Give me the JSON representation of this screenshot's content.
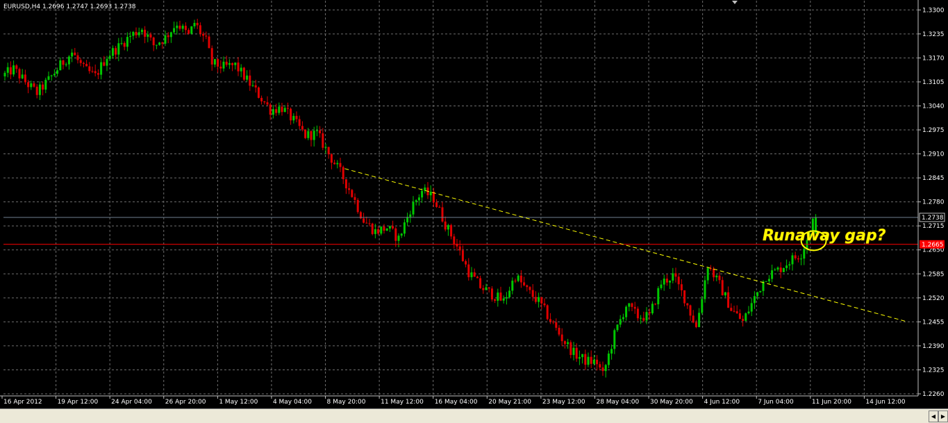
{
  "header": {
    "symbol_info": "EURUSD,H4  1.2696 1.2747 1.2693 1.2738"
  },
  "annotation": {
    "text": "Runaway gap?"
  },
  "colors": {
    "background": "#000000",
    "grid": "#6e6e6e",
    "bull": "#00c800",
    "bear": "#e00000",
    "trendline": "#ffff00",
    "annotation": "#ffff00",
    "bid_line": "#ff0000",
    "ask_line": "#708090",
    "text": "#ffffff"
  },
  "chart_data": {
    "type": "candlestick",
    "title": "EURUSD,H4",
    "ohlc": {
      "open": 1.2696,
      "high": 1.2747,
      "low": 1.2693,
      "close": 1.2738
    },
    "ylim": [
      1.226,
      1.3325
    ],
    "y_ticks": [
      "1.3300",
      "1.3235",
      "1.3170",
      "1.3105",
      "1.3040",
      "1.2975",
      "1.2910",
      "1.2845",
      "1.2780",
      "1.2715",
      "1.2650",
      "1.2585",
      "1.2520",
      "1.2455",
      "1.2390",
      "1.2325",
      "1.2260"
    ],
    "x_ticks": [
      "16 Apr 2012",
      "19 Apr 12:00",
      "24 Apr 04:00",
      "26 Apr 20:00",
      "1 May 12:00",
      "4 May 04:00",
      "8 May 20:00",
      "11 May 12:00",
      "16 May 04:00",
      "20 May 21:00",
      "23 May 12:00",
      "28 May 04:00",
      "30 May 20:00",
      "4 Jun 12:00",
      "7 Jun 04:00",
      "11 Jun 20:00",
      "14 Jun 12:00"
    ],
    "price_labels": {
      "ask": "1.2738",
      "bid": "1.2665"
    },
    "bid_level": 1.2665,
    "ask_level": 1.2738,
    "trendline": {
      "start": {
        "bar": 117,
        "price": 1.287
      },
      "end": {
        "bar": 310,
        "price": 1.2455
      }
    },
    "gap_marker_price": 1.2675,
    "path": [
      [
        0,
        1.312
      ],
      [
        4,
        1.314
      ],
      [
        8,
        1.3105
      ],
      [
        12,
        1.3075
      ],
      [
        16,
        1.311
      ],
      [
        20,
        1.315
      ],
      [
        24,
        1.3185
      ],
      [
        28,
        1.314
      ],
      [
        32,
        1.312
      ],
      [
        36,
        1.3175
      ],
      [
        40,
        1.32
      ],
      [
        44,
        1.323
      ],
      [
        48,
        1.325
      ],
      [
        52,
        1.3205
      ],
      [
        56,
        1.3225
      ],
      [
        60,
        1.3265
      ],
      [
        64,
        1.323
      ],
      [
        66,
        1.3265
      ],
      [
        70,
        1.3215
      ],
      [
        72,
        1.3155
      ],
      [
        76,
        1.3145
      ],
      [
        80,
        1.315
      ],
      [
        84,
        1.311
      ],
      [
        88,
        1.307
      ],
      [
        92,
        1.303
      ],
      [
        96,
        1.3035
      ],
      [
        100,
        1.3
      ],
      [
        104,
        1.296
      ],
      [
        108,
        1.2965
      ],
      [
        112,
        1.291
      ],
      [
        116,
        1.286
      ],
      [
        120,
        1.28
      ],
      [
        124,
        1.273
      ],
      [
        128,
        1.27
      ],
      [
        132,
        1.271
      ],
      [
        136,
        1.268
      ],
      [
        140,
        1.276
      ],
      [
        144,
        1.281
      ],
      [
        148,
        1.279
      ],
      [
        152,
        1.272
      ],
      [
        156,
        1.266
      ],
      [
        160,
        1.259
      ],
      [
        164,
        1.255
      ],
      [
        168,
        1.253
      ],
      [
        172,
        1.251
      ],
      [
        176,
        1.258
      ],
      [
        180,
        1.254
      ],
      [
        184,
        1.251
      ],
      [
        188,
        1.246
      ],
      [
        192,
        1.241
      ],
      [
        196,
        1.237
      ],
      [
        200,
        1.235
      ],
      [
        204,
        1.2345
      ],
      [
        206,
        1.231
      ],
      [
        210,
        1.242
      ],
      [
        214,
        1.25
      ],
      [
        218,
        1.247
      ],
      [
        222,
        1.247
      ],
      [
        226,
        1.256
      ],
      [
        230,
        1.258
      ],
      [
        234,
        1.252
      ],
      [
        238,
        1.244
      ],
      [
        242,
        1.261
      ],
      [
        246,
        1.2555
      ],
      [
        250,
        1.249
      ],
      [
        254,
        1.2455
      ],
      [
        258,
        1.252
      ],
      [
        262,
        1.258
      ],
      [
        266,
        1.2595
      ],
      [
        270,
        1.262
      ],
      [
        274,
        1.264
      ],
      [
        277,
        1.27
      ],
      [
        278,
        1.273
      ]
    ]
  }
}
